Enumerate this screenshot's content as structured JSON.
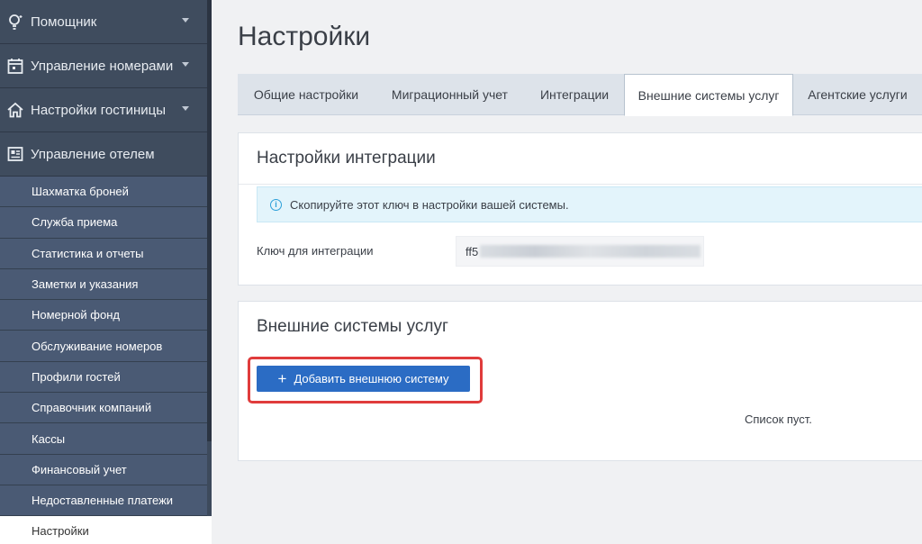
{
  "sidebar": {
    "top_items": [
      {
        "label": "Помощник",
        "icon": "lightbulb-icon"
      },
      {
        "label": "Управление номерами",
        "icon": "calendar-icon"
      },
      {
        "label": "Настройки гостиницы",
        "icon": "home-icon"
      },
      {
        "label": "Управление отелем",
        "icon": "dashboard-icon"
      }
    ],
    "sub_items": [
      "Шахматка броней",
      "Служба приема",
      "Статистика и отчеты",
      "Заметки и указания",
      "Номерной фонд",
      "Обслуживание номеров",
      "Профили гостей",
      "Справочник компаний",
      "Кассы",
      "Финансовый учет",
      "Недоставленные платежи",
      "Настройки"
    ],
    "active_item": "Настройки"
  },
  "main": {
    "title": "Настройки",
    "tabs": [
      {
        "label": "Общие настройки"
      },
      {
        "label": "Миграционный учет"
      },
      {
        "label": "Интеграции"
      },
      {
        "label": "Внешние системы услуг",
        "active": true
      },
      {
        "label": "Агентские услуги"
      }
    ],
    "integration": {
      "title": "Настройки интеграции",
      "info_text": "Скопируйте этот ключ в настройки вашей системы.",
      "key_label": "Ключ для интеграции",
      "key_value_prefix": "ff5"
    },
    "external_systems": {
      "title": "Внешние системы услуг",
      "add_button_label": "Добавить внешнюю систему",
      "empty_text": "Список пуст."
    }
  },
  "colors": {
    "sidebar_bg": "#3d4a5c",
    "sidebar_sub_bg": "#4a5a74",
    "primary_button": "#2b6cc4",
    "highlight": "#e03c3c",
    "info_bg": "#e3f4fb"
  }
}
